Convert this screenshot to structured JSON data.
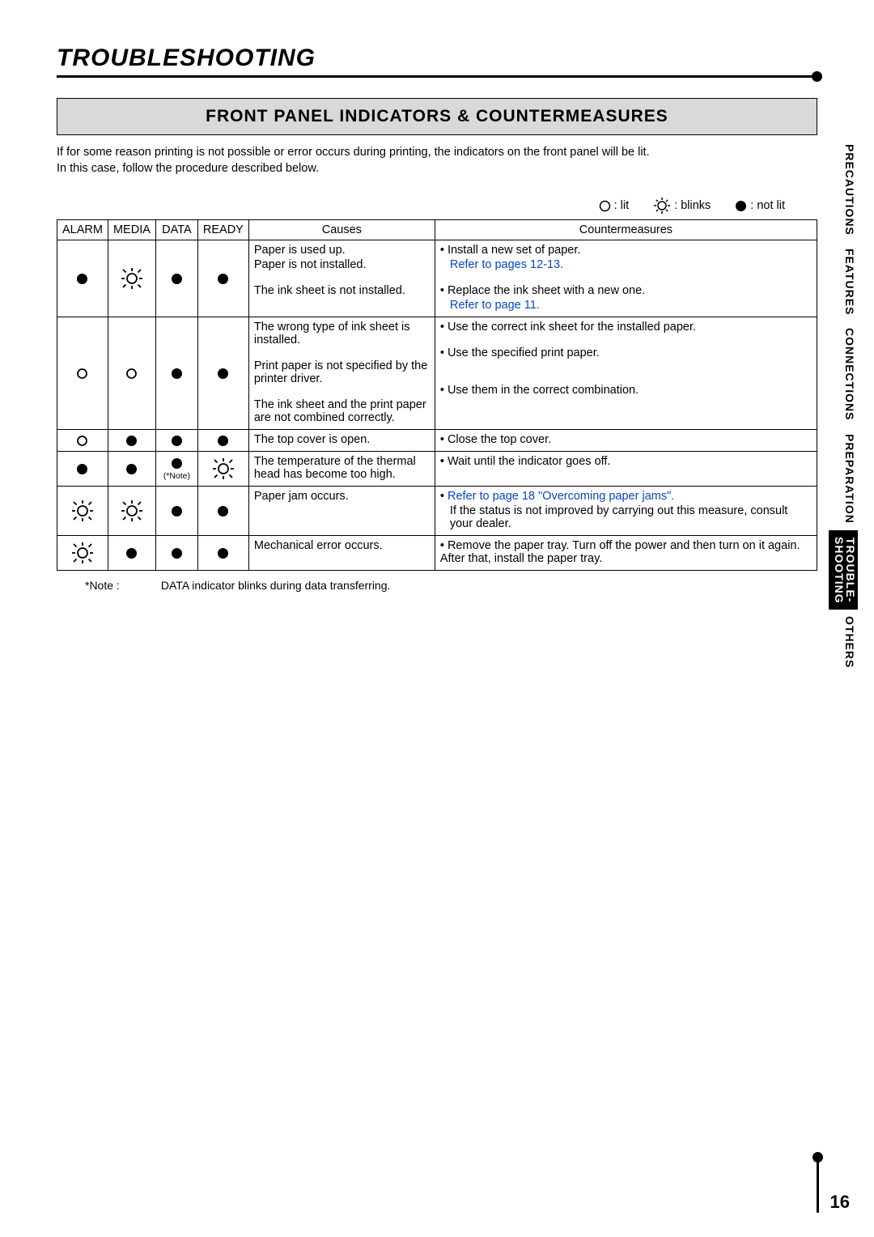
{
  "page": {
    "title": "TROUBLESHOOTING",
    "section_heading": "FRONT PANEL INDICATORS & COUNTERMEASURES",
    "intro_line1": "If for some reason printing is not possible or error occurs during printing, the indicators on the front panel will be lit.",
    "intro_line2": "In this case, follow the procedure described below.",
    "page_number": "16"
  },
  "legend": {
    "lit": ": lit",
    "blinks": ": blinks",
    "not_lit": ": not lit"
  },
  "table": {
    "headers": {
      "alarm": "ALARM",
      "media": "MEDIA",
      "data": "DATA",
      "ready": "READY",
      "causes": "Causes",
      "counter": "Countermeasures"
    },
    "note_under_data": "(*Note)"
  },
  "rows": [
    {
      "alarm": "not_lit",
      "media": "blinks",
      "data": "not_lit",
      "ready": "not_lit",
      "causes": [
        "Paper is used up.",
        "Paper is not installed.",
        "",
        "The ink sheet is not installed."
      ],
      "counter": [
        {
          "bullet": "• ",
          "text": "Install a new set of paper."
        },
        {
          "link": true,
          "text": "Refer to pages 12-13."
        },
        {
          "spacer": true
        },
        {
          "bullet": "• ",
          "text": "Replace the ink sheet with a new one."
        },
        {
          "link": true,
          "text": "Refer to page 11."
        }
      ]
    },
    {
      "alarm": "lit",
      "media": "lit",
      "data": "not_lit",
      "ready": "not_lit",
      "causes": [
        "The wrong type of ink sheet is installed.",
        "",
        "Print paper is not specified by the printer driver.",
        "",
        "The ink sheet and the print paper are not combined correctly."
      ],
      "counter": [
        {
          "bullet": "• ",
          "text": "Use the correct ink sheet for the installed paper."
        },
        {
          "spacer": true
        },
        {
          "bullet": "• ",
          "text": "Use the specified print paper."
        },
        {
          "spacer": true
        },
        {
          "spacer": true
        },
        {
          "bullet": "• ",
          "text": "Use them in the correct combination."
        }
      ]
    },
    {
      "alarm": "lit",
      "media": "not_lit",
      "data": "not_lit",
      "ready": "not_lit",
      "causes": [
        "The top cover is open."
      ],
      "counter": [
        {
          "bullet": "• ",
          "text": "Close the top cover."
        }
      ]
    },
    {
      "alarm": "not_lit",
      "media": "not_lit",
      "data": "not_lit_note",
      "ready": "blinks",
      "causes": [
        "The temperature of the thermal head has become too high."
      ],
      "counter": [
        {
          "bullet": "• ",
          "text": "Wait until the indicator goes off."
        }
      ]
    },
    {
      "alarm": "blinks",
      "media": "blinks",
      "data": "not_lit",
      "ready": "not_lit",
      "causes": [
        "Paper jam occurs."
      ],
      "counter": [
        {
          "bullet": "• ",
          "link": true,
          "text": "Refer to page 18 \"Overcoming paper jams\"."
        },
        {
          "indent": true,
          "text": "If the status is not improved by carrying out this measure, consult your dealer."
        }
      ]
    },
    {
      "alarm": "blinks",
      "media": "not_lit",
      "data": "not_lit",
      "ready": "not_lit",
      "causes": [
        "Mechanical error occurs."
      ],
      "counter": [
        {
          "bullet": "• ",
          "text": "Remove the paper tray. Turn off the power and then turn on it again. After that, install the paper tray."
        }
      ]
    }
  ],
  "footnote": {
    "label": "*Note :",
    "text": "DATA indicator blinks during data transferring."
  },
  "tabs": {
    "precautions": "PRECAUTIONS",
    "features": "FEATURES",
    "connections": "CONNECTIONS",
    "preparation": "PREPARATION",
    "troubleshooting": "TROUBLE-\nSHOOTING",
    "others": "OTHERS"
  }
}
